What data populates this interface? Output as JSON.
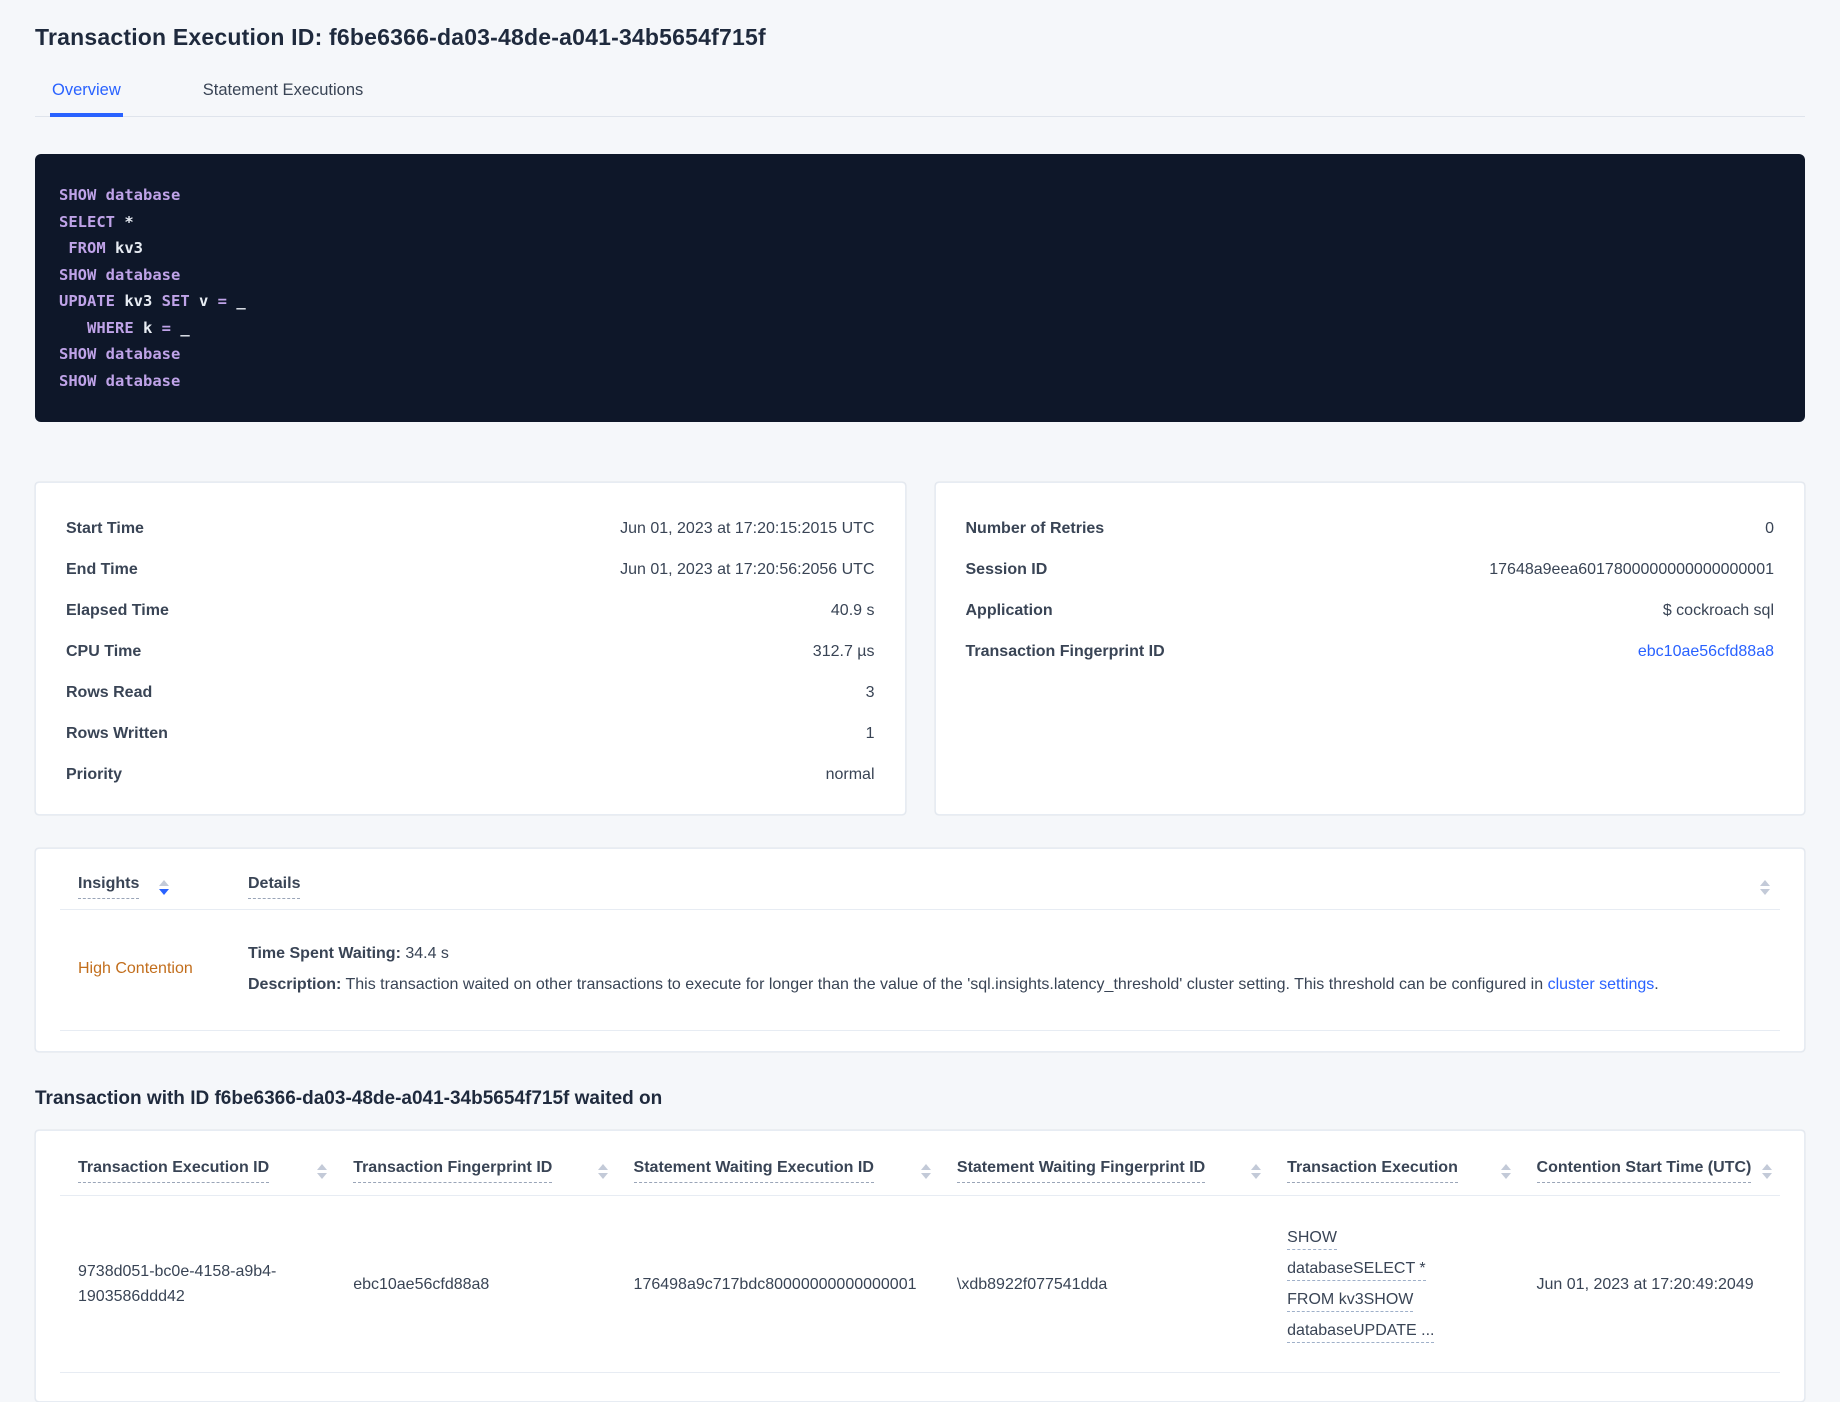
{
  "page": {
    "title": "Transaction Execution ID: f6be6366-da03-48de-a041-34b5654f715f",
    "tabs": [
      {
        "label": "Overview",
        "active": true
      },
      {
        "label": "Statement Executions",
        "active": false
      }
    ]
  },
  "sql_box": {
    "lines": [
      [
        {
          "type": "kw",
          "text": "SHOW"
        },
        {
          "type": "pl",
          "text": " "
        },
        {
          "type": "kw",
          "text": "database"
        }
      ],
      [
        {
          "type": "kw",
          "text": "SELECT"
        },
        {
          "type": "pl",
          "text": " *"
        }
      ],
      [
        {
          "type": "pl",
          "text": " "
        },
        {
          "type": "kw",
          "text": "FROM"
        },
        {
          "type": "pl",
          "text": " kv3"
        }
      ],
      [
        {
          "type": "kw",
          "text": "SHOW"
        },
        {
          "type": "pl",
          "text": " "
        },
        {
          "type": "kw",
          "text": "database"
        }
      ],
      [
        {
          "type": "kw",
          "text": "UPDATE"
        },
        {
          "type": "pl",
          "text": " kv3 "
        },
        {
          "type": "kw",
          "text": "SET"
        },
        {
          "type": "pl",
          "text": " v "
        },
        {
          "type": "kw",
          "text": "="
        },
        {
          "type": "pl",
          "text": " _"
        }
      ],
      [
        {
          "type": "pl",
          "text": "   "
        },
        {
          "type": "kw",
          "text": "WHERE"
        },
        {
          "type": "pl",
          "text": " k "
        },
        {
          "type": "kw",
          "text": "="
        },
        {
          "type": "pl",
          "text": " _"
        }
      ],
      [
        {
          "type": "kw",
          "text": "SHOW"
        },
        {
          "type": "pl",
          "text": " "
        },
        {
          "type": "kw",
          "text": "database"
        }
      ],
      [
        {
          "type": "kw",
          "text": "SHOW"
        },
        {
          "type": "pl",
          "text": " "
        },
        {
          "type": "kw",
          "text": "database"
        }
      ]
    ]
  },
  "summary_cards": [
    {
      "id": "execution-summary",
      "rows": [
        {
          "label": "Start Time",
          "value": "Jun 01, 2023 at 17:20:15:2015 UTC"
        },
        {
          "label": "End Time",
          "value": "Jun 01, 2023 at 17:20:56:2056 UTC"
        },
        {
          "label": "Elapsed Time",
          "value": "40.9 s"
        },
        {
          "label": "CPU Time",
          "value": "312.7 µs"
        },
        {
          "label": "Rows Read",
          "value": "3"
        },
        {
          "label": "Rows Written",
          "value": "1"
        },
        {
          "label": "Priority",
          "value": "normal"
        }
      ]
    },
    {
      "id": "session-summary",
      "rows": [
        {
          "label": "Number of Retries",
          "value": "0"
        },
        {
          "label": "Session ID",
          "value": "17648a9eea6017800000000000000001"
        },
        {
          "label": "Application",
          "value": "$ cockroach sql"
        },
        {
          "label": "Transaction Fingerprint ID",
          "value": "ebc10ae56cfd88a8",
          "link": true
        }
      ]
    }
  ],
  "insights_table": {
    "columns": [
      {
        "label": "Insights"
      },
      {
        "label": "Details"
      }
    ],
    "row": {
      "insight": "High Contention",
      "waiting_label": "Time Spent Waiting:",
      "waiting_value": "34.4 s",
      "description_label": "Description:",
      "description_text": "This transaction waited on other transactions to execute for longer than the value of the 'sql.insights.latency_threshold' cluster setting. This threshold can be configured in",
      "description_link": "cluster settings",
      "description_suffix": "."
    }
  },
  "waited_on": {
    "heading": "Transaction with ID f6be6366-da03-48de-a041-34b5654f715f waited on",
    "columns": [
      "Transaction Execution ID",
      "Transaction Fingerprint ID",
      "Statement Waiting Execution ID",
      "Statement Waiting Fingerprint ID",
      "Transaction Execution",
      "Contention Start Time (UTC)"
    ],
    "rows": [
      {
        "cells": [
          {
            "text": "9738d051-bc0e-4158-a9b4-1903586ddd42"
          },
          {
            "text": "ebc10ae56cfd88a8"
          },
          {
            "text": "176498a9c717bdc80000000000000001"
          },
          {
            "text": "\\xdb8922f077541dda"
          },
          {
            "text": "SHOW databaseSELECT * FROM kv3SHOW databaseUPDATE ...",
            "link": true
          },
          {
            "text": "Jun 01, 2023 at 17:20:49:2049"
          }
        ]
      }
    ]
  },
  "colors": {
    "accent_blue": "#2962ff",
    "insight_orange": "#c26e1c",
    "code_background": "#0e1729",
    "sql_keyword": "#bfa3e8",
    "sql_identifier": "#e7ecf3",
    "page_background": "#f5f7fa"
  }
}
